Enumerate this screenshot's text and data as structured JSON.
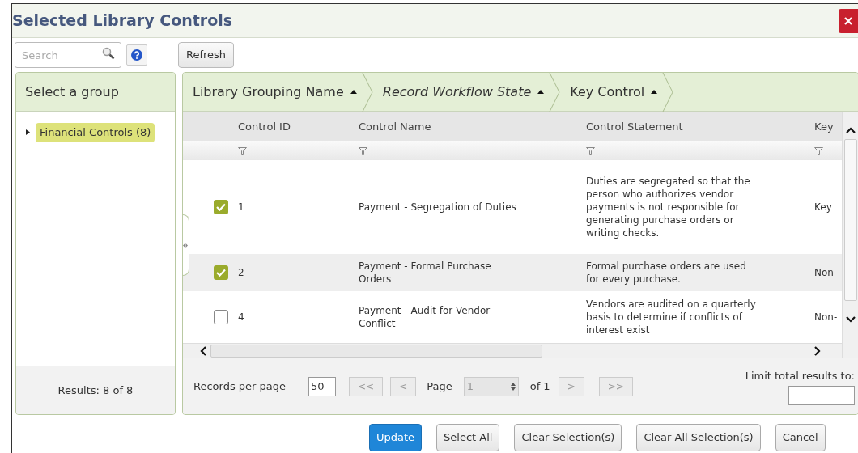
{
  "window": {
    "title": "Selected Library Controls"
  },
  "toolbar": {
    "search": {
      "placeholder": "Search"
    },
    "refresh_button": "Refresh"
  },
  "groups_panel": {
    "header": "Select a group",
    "items": [
      {
        "label": "Financial Controls (8)",
        "selected": true,
        "expanded": false
      }
    ],
    "footer": "Results: 8 of 8"
  },
  "grouping": [
    {
      "label": "Library Grouping Name",
      "emphasized": false
    },
    {
      "label": "Record Workflow State",
      "emphasized": true
    },
    {
      "label": "Key Control",
      "emphasized": false
    }
  ],
  "table": {
    "columns": [
      "Control ID",
      "Control Name",
      "Control Statement",
      "Key"
    ],
    "rows": [
      {
        "checked": true,
        "id": "1",
        "name": "Payment - Segregation of Duties",
        "statement": "Duties are segregated so that the person who authorizes vendor payments is not responsible for generating purchase orders or writing checks.",
        "key": "Key"
      },
      {
        "checked": true,
        "id": "2",
        "name": "Payment - Formal Purchase Orders",
        "statement": "Formal purchase orders are used for every purchase.",
        "key": "Non-"
      },
      {
        "checked": false,
        "id": "4",
        "name": "Payment - Audit for Vendor Conflict",
        "statement": "Vendors are audited on a quarterly basis to determine if conflicts of interest exist",
        "key": "Non-"
      }
    ]
  },
  "pager": {
    "records_label": "Records per page",
    "per_page": "50",
    "nav_back": [
      {
        "label": "<<",
        "disabled": true
      },
      {
        "label": "<",
        "disabled": true
      }
    ],
    "page_label": "Page",
    "page": "1",
    "of_label": "of 1",
    "nav_forward": [
      {
        "label": ">",
        "disabled": true
      },
      {
        "label": ">>",
        "disabled": true
      }
    ],
    "limit_label": "Limit total results to:"
  },
  "buttons": [
    {
      "label": "Update",
      "kind": "primary"
    },
    {
      "label": "Select All",
      "kind": "default"
    },
    {
      "label": "Clear Selection(s)",
      "kind": "default"
    },
    {
      "label": "Clear All Selection(s)",
      "kind": "default"
    },
    {
      "label": "Cancel",
      "kind": "default"
    }
  ]
}
